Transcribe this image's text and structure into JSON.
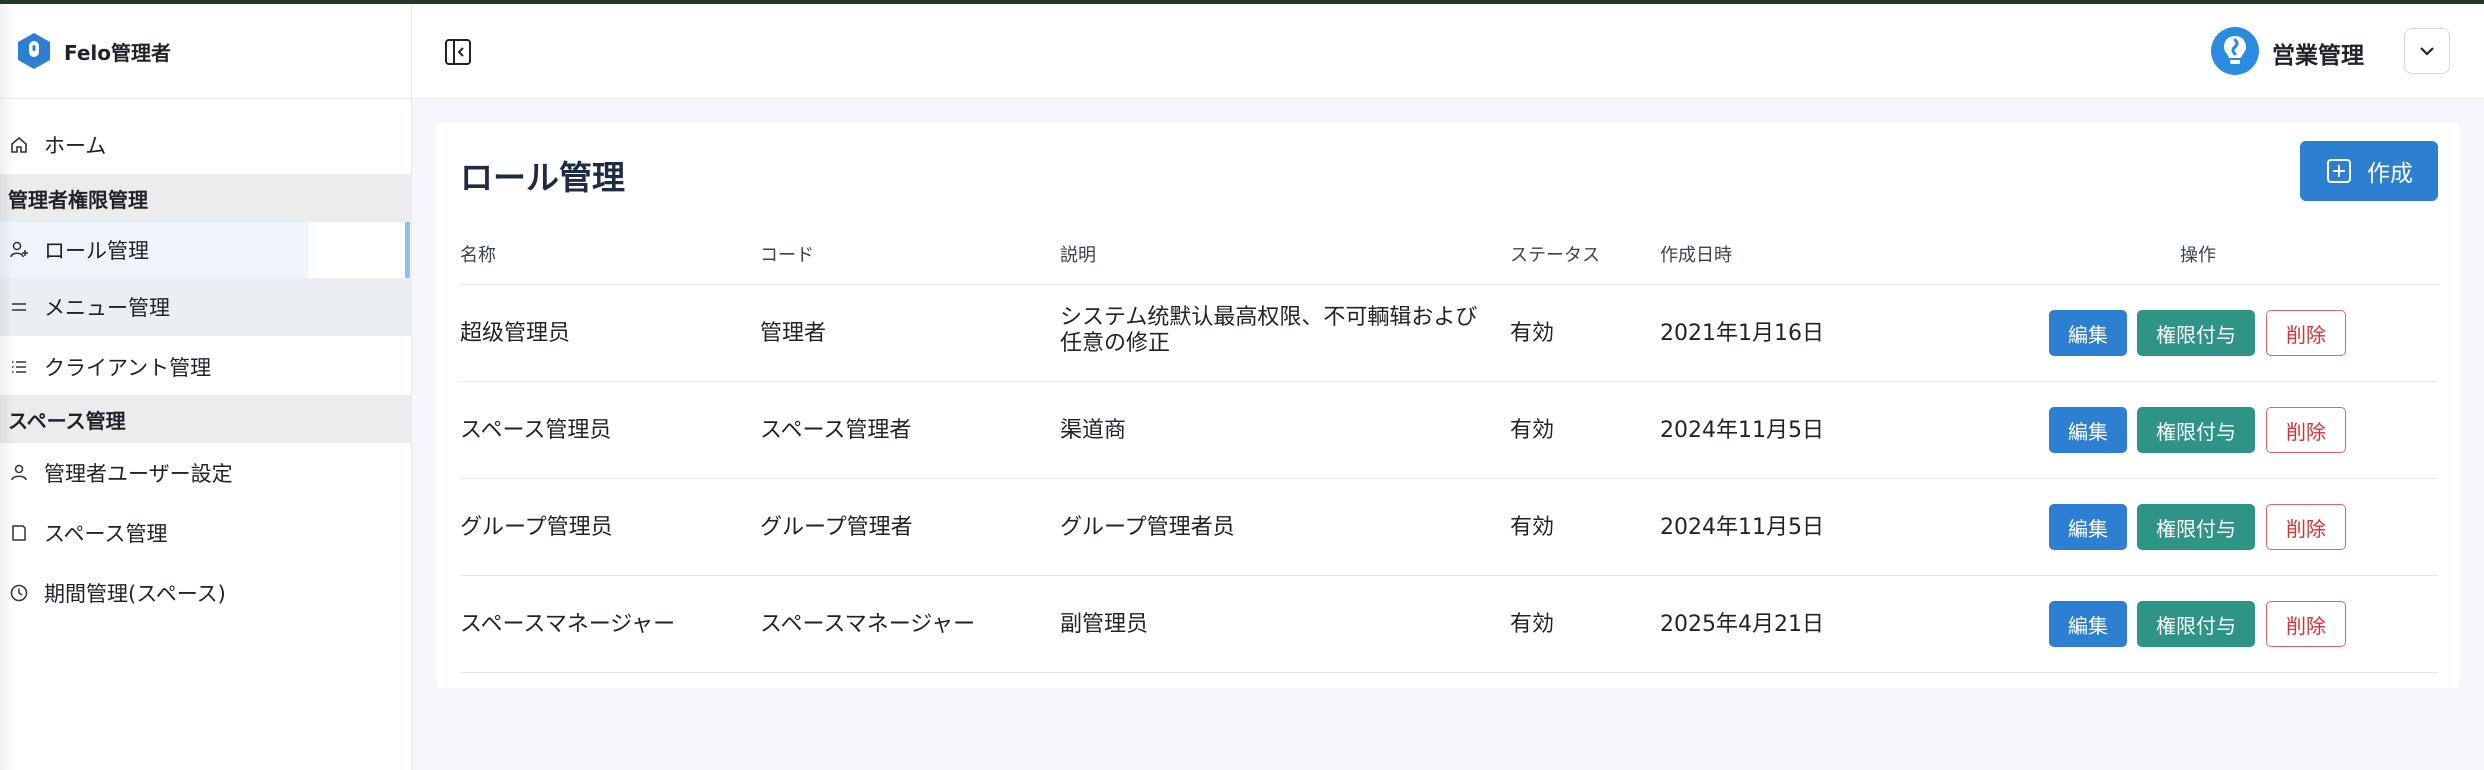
{
  "brand": {
    "name": "Felo管理者"
  },
  "sidebar": {
    "home": "ホーム",
    "section_admin": "管理者権限管理",
    "role_mgmt": "ロール管理",
    "menu_mgmt": "メニュー管理",
    "client_mgmt": "クライアント管理",
    "section_space": "スペース管理",
    "admin_user_settings": "管理者ユーザー設定",
    "space_mgmt": "スペース管理",
    "period_mgmt": "期間管理(スペース)"
  },
  "header": {
    "user_name": "営業管理"
  },
  "main": {
    "title": "ロール管理",
    "create_label": "作成",
    "columns": [
      "名称",
      "コード",
      "説明",
      "ステータス",
      "作成日時",
      "操作"
    ],
    "rows": [
      {
        "name": "超级管理员",
        "code": "管理者",
        "desc": "システム统默认最高权限、不可輌辑および任意の修正",
        "desc_line1": "システム统默认最高权限、不可輌辑および",
        "desc_line2": "任意の修正",
        "status": "有効",
        "created": "2021年1月16日"
      },
      {
        "name": "スペース管理员",
        "code": "スペース管理者",
        "desc": "渠道商",
        "desc_line1": "渠道商",
        "desc_line2": "",
        "status": "有効",
        "created": "2024年11月5日"
      },
      {
        "name": "グループ管理员",
        "code": "グループ管理者",
        "desc": "グループ管理者员",
        "desc_line1": "グループ管理者员",
        "desc_line2": "",
        "status": "有効",
        "created": "2024年11月5日"
      },
      {
        "name": "スペースマネージャー",
        "code": "スペースマネージャー",
        "desc": "副管理员",
        "desc_line1": "副管理员",
        "desc_line2": "",
        "status": "有効",
        "created": "2025年4月21日"
      }
    ],
    "actions": {
      "edit": "編集",
      "grant": "権限付与",
      "delete": "削除"
    }
  },
  "colors": {
    "primary": "#2d7fd2",
    "teal": "#2e9486",
    "danger": "#d93030",
    "title": "#1f2a44"
  }
}
